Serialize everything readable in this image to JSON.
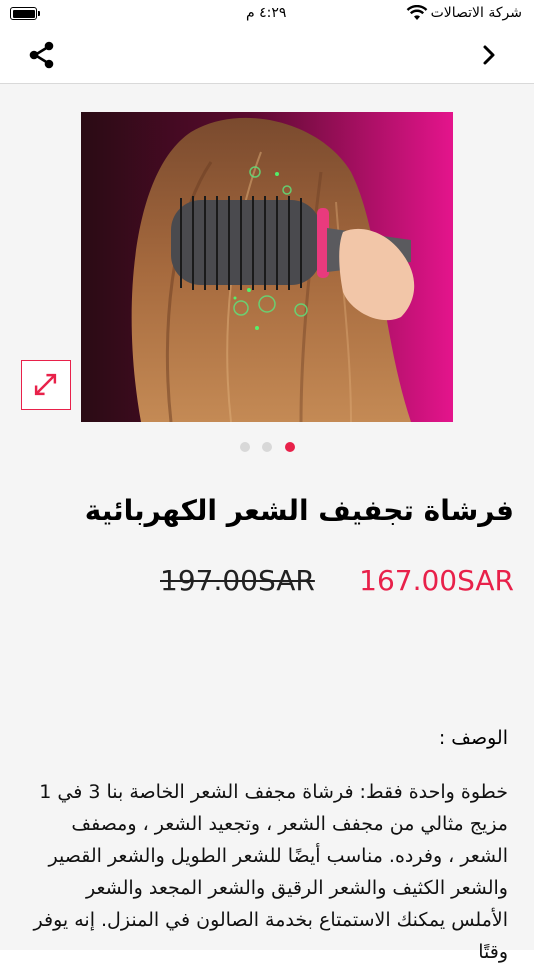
{
  "status_bar": {
    "time": "٤:٢٩ م",
    "carrier": "شركة الاتصالات",
    "icons": [
      "battery-icon",
      "wifi-icon"
    ]
  },
  "nav": {
    "icons": [
      "share-icon",
      "chevron-right-icon"
    ]
  },
  "product": {
    "title": "فرشاة تجفيف الشعر الكهربائية",
    "price": "167.00SAR",
    "old_price": "197.00SAR",
    "image_count": 3,
    "active_image_index": 2,
    "description_label": "الوصف :",
    "description": "خطوة واحدة فقط: فرشاة مجفف الشعر الخاصة بنا 3 في 1 مزيج مثالي من مجفف الشعر ، وتجعيد الشعر ، ومصفف الشعر ، وفرده. مناسب أيضًا للشعر الطويل والشعر القصير والشعر الكثيف والشعر الرقيق والشعر المجعد والشعر الأملس يمكنك الاستمتاع بخدمة الصالون في المنزل. إنه يوفر وقتًا"
  },
  "colors": {
    "accent": "#e8214a",
    "background": "#f5f5f5"
  }
}
